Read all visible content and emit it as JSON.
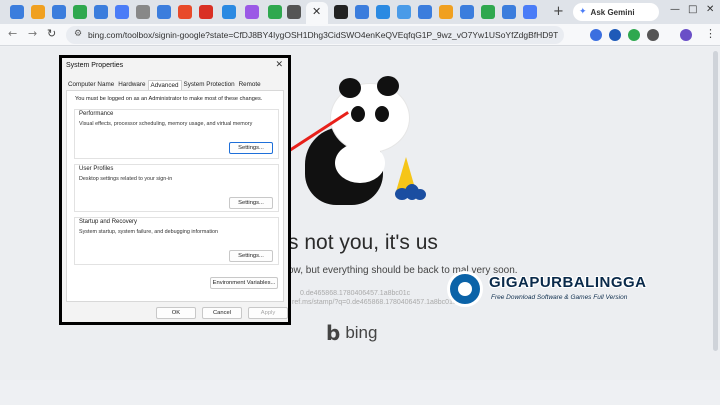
{
  "browser": {
    "tab_icon_colors": [
      "#3b7ddd",
      "#f0a020",
      "#3b7ddd",
      "#2fa84f",
      "#3b7ddd",
      "#4a7cf7",
      "#888888",
      "#3b7ddd",
      "#e84a2a",
      "#d93025",
      "#2b8ae2",
      "#9b59e6",
      "#2fa84f",
      "#555555",
      "#222222",
      "#3b7ddd",
      "#2b8ae2",
      "#4a9be8"
    ],
    "ask_gemini_label": "Ask Gemini",
    "url": "bing.com/toolbox/signin-google?state=CfDJ8BY4IygOSH1Dhg3CidSWO4enKeQVEqfqG1P_9wz_vO7Yw1USoYfZdgBfHD9Tg8ka4DPou..."
  },
  "page": {
    "headline": "s not you, it's us",
    "subline": "ow, but everything should be back to      mal very soon.",
    "ref_line1": "0.de465868.1780406457.1a8bc01c",
    "ref_line2": "ref.ms/stamp/?q=0.de465868.1780406457.1a8bc01c",
    "bing_label": "bing",
    "bing_mark": "b"
  },
  "watermark": {
    "title": "GIGAPURBALINGGA",
    "tagline": "Free Download Software & Games Full Version"
  },
  "dialog": {
    "title": "System Properties",
    "close": "✕",
    "tabs": [
      "Computer Name",
      "Hardware",
      "Advanced",
      "System Protection",
      "Remote"
    ],
    "admin_note": "You must be logged on as an Administrator to make most of these changes.",
    "performance": {
      "label": "Performance",
      "desc": "Visual effects, processor scheduling, memory usage, and virtual memory",
      "button": "Settings..."
    },
    "user_profiles": {
      "label": "User Profiles",
      "desc": "Desktop settings related to your sign-in",
      "button": "Settings..."
    },
    "startup": {
      "label": "Startup and Recovery",
      "desc": "System startup, system failure, and debugging information",
      "button": "Settings..."
    },
    "env_button": "Environment Variables...",
    "ok": "OK",
    "cancel": "Cancel",
    "apply": "Apply"
  }
}
